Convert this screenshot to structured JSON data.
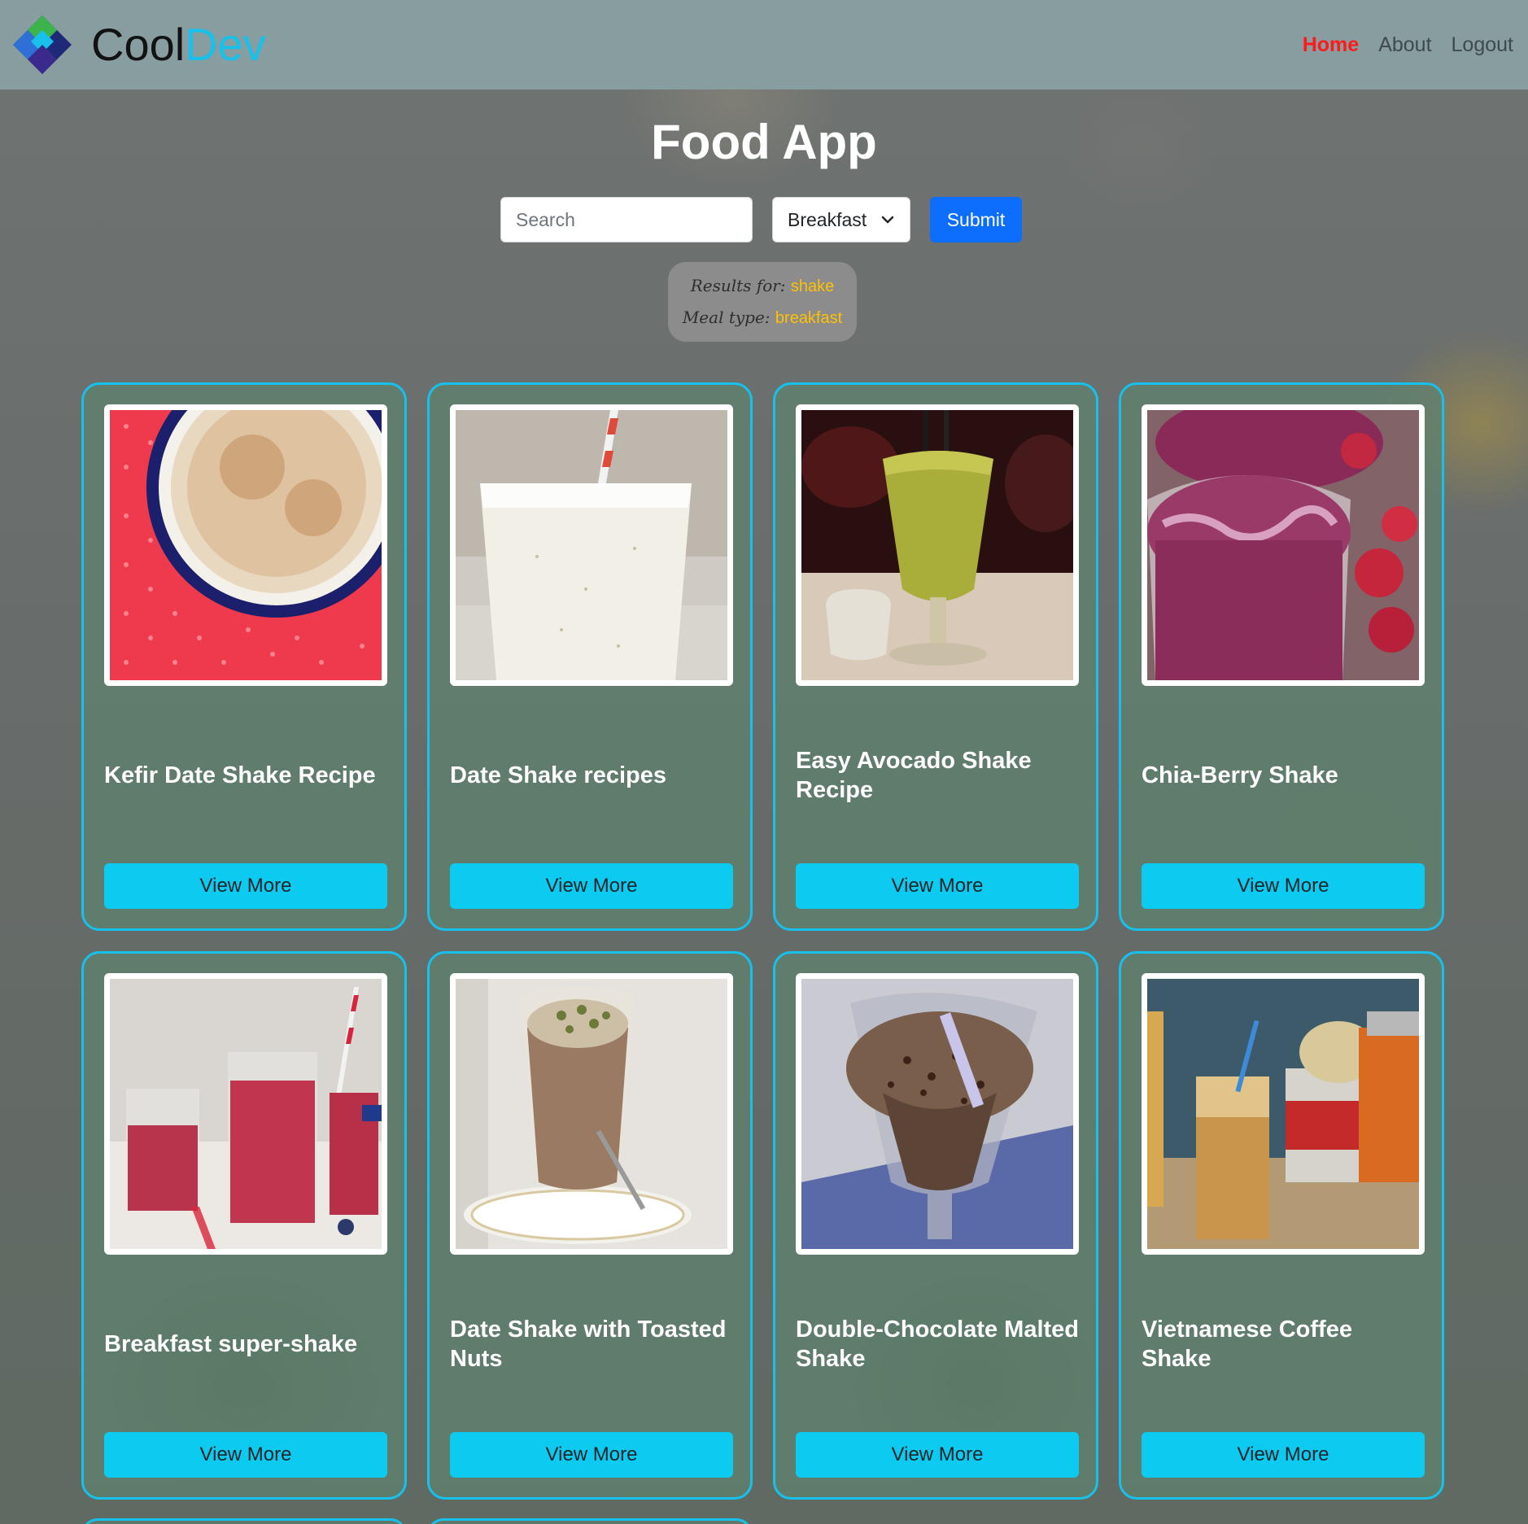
{
  "navbar": {
    "brand_part1": "Cool",
    "brand_part2": "Dev",
    "links": [
      {
        "label": "Home",
        "active": true
      },
      {
        "label": "About",
        "active": false
      },
      {
        "label": "Logout",
        "active": false
      }
    ]
  },
  "page": {
    "title": "Food App"
  },
  "search": {
    "placeholder": "Search",
    "value": "",
    "meal_select": "Breakfast",
    "submit_label": "Submit"
  },
  "results": {
    "query_label": "Results for:",
    "query_value": "shake",
    "meal_label": "Meal type:",
    "meal_value": "breakfast"
  },
  "recipes": [
    {
      "title": "Kefir Date Shake Recipe",
      "button": "View More",
      "image": "kefir-shake-image"
    },
    {
      "title": "Date Shake recipes",
      "button": "View More",
      "image": "date-shake-image"
    },
    {
      "title": "Easy Avocado Shake Recipe",
      "button": "View More",
      "image": "avocado-shake-image"
    },
    {
      "title": "Chia-Berry Shake",
      "button": "View More",
      "image": "chia-berry-shake-image"
    },
    {
      "title": "Breakfast super-shake",
      "button": "View More",
      "image": "super-shake-image"
    },
    {
      "title": "Date Shake with Toasted Nuts",
      "button": "View More",
      "image": "date-nut-shake-image"
    },
    {
      "title": "Double-Chocolate Malted Shake",
      "button": "View More",
      "image": "chocolate-malted-shake-image"
    },
    {
      "title": "Vietnamese Coffee Shake",
      "button": "View More",
      "image": "vietnamese-coffee-shake-image"
    }
  ],
  "colors": {
    "navbar_bg": "#879da0",
    "brand_accent": "#17c1ec",
    "active_link": "#ff1a1a",
    "card_border": "#17c1ec",
    "view_button": "#0dcaf0",
    "submit_button": "#0d6efd",
    "highlight": "#ffc107"
  }
}
